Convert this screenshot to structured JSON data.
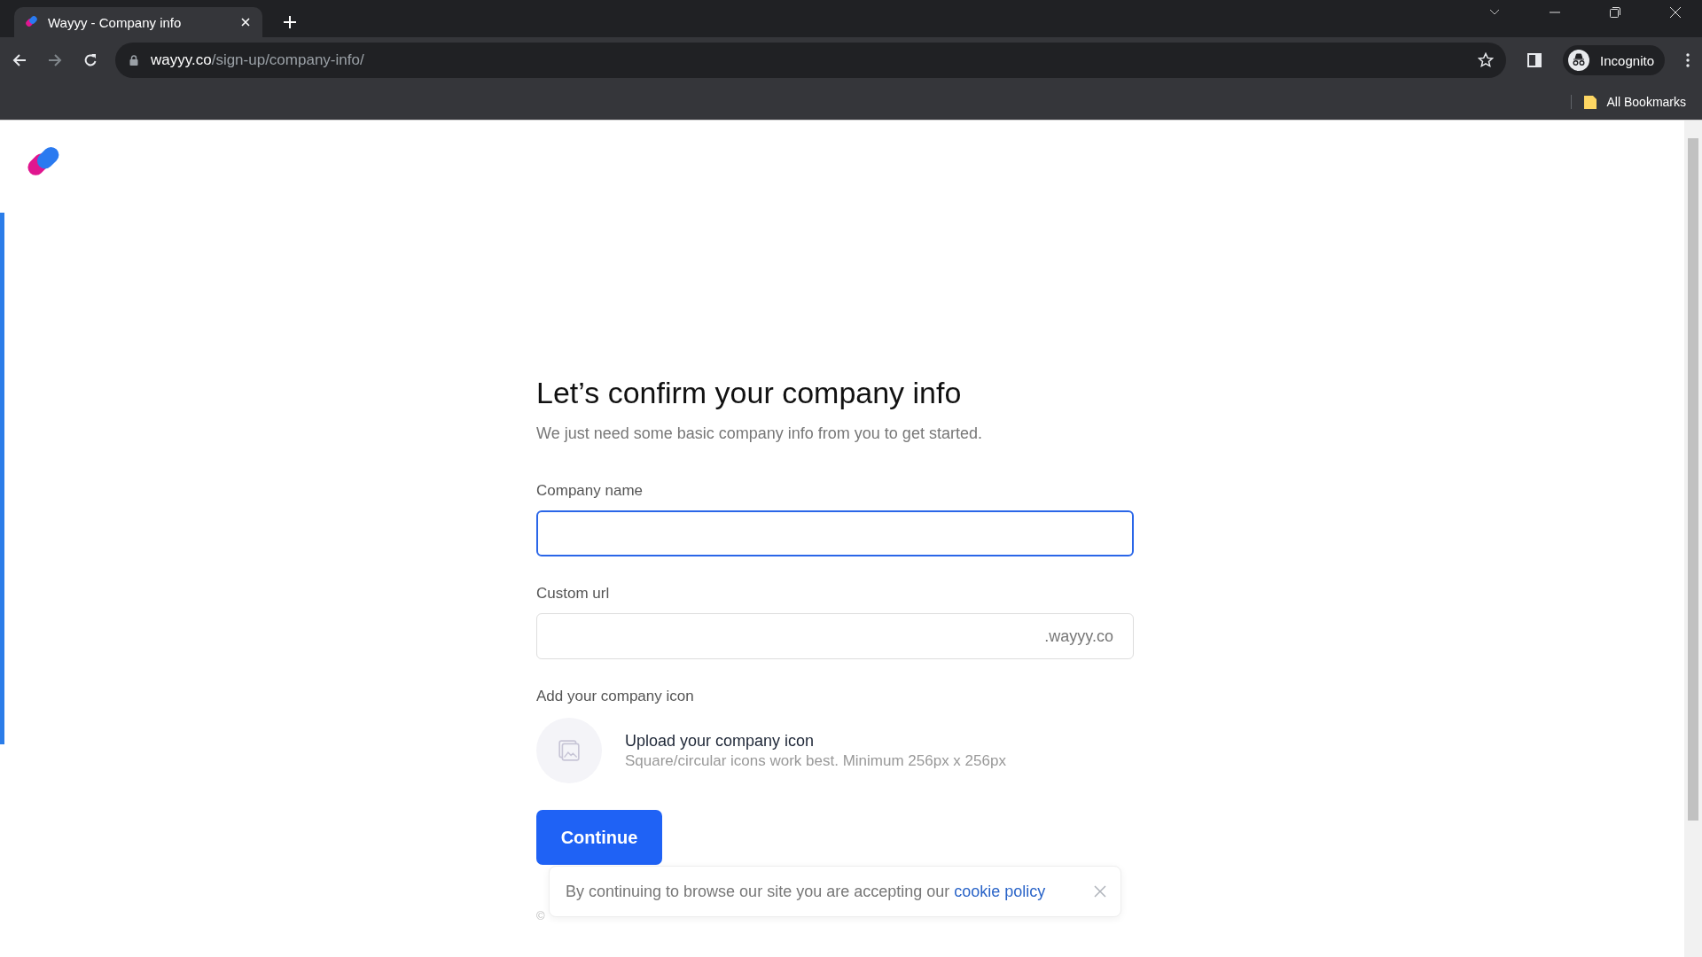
{
  "browser": {
    "tab": {
      "title": "Wayyy - Company info",
      "selected": true
    },
    "address": {
      "domain": "wayyy.co",
      "path": "/sign-up/company-info/"
    },
    "profile": "Incognito",
    "bookmarks": [
      "All Bookmarks"
    ]
  },
  "page": {
    "heading": "Let’s confirm your company info",
    "subtitle": "We just need some basic company info from you to get started.",
    "fields": [
      {
        "label": "Company name",
        "focused": true
      },
      {
        "label": "Custom url",
        "focused": false,
        "suffix": ".wayyy.co"
      }
    ],
    "icon_upload": {
      "label": "Add your company icon",
      "title": "Upload your company icon",
      "hint": "Square/circular icons work best. Minimum 256px x 256px"
    },
    "button": "Continue",
    "cookie_banner": {
      "text": "By continuing to browse our site you are accepting our",
      "link": "cookie policy"
    },
    "footer": "©"
  }
}
